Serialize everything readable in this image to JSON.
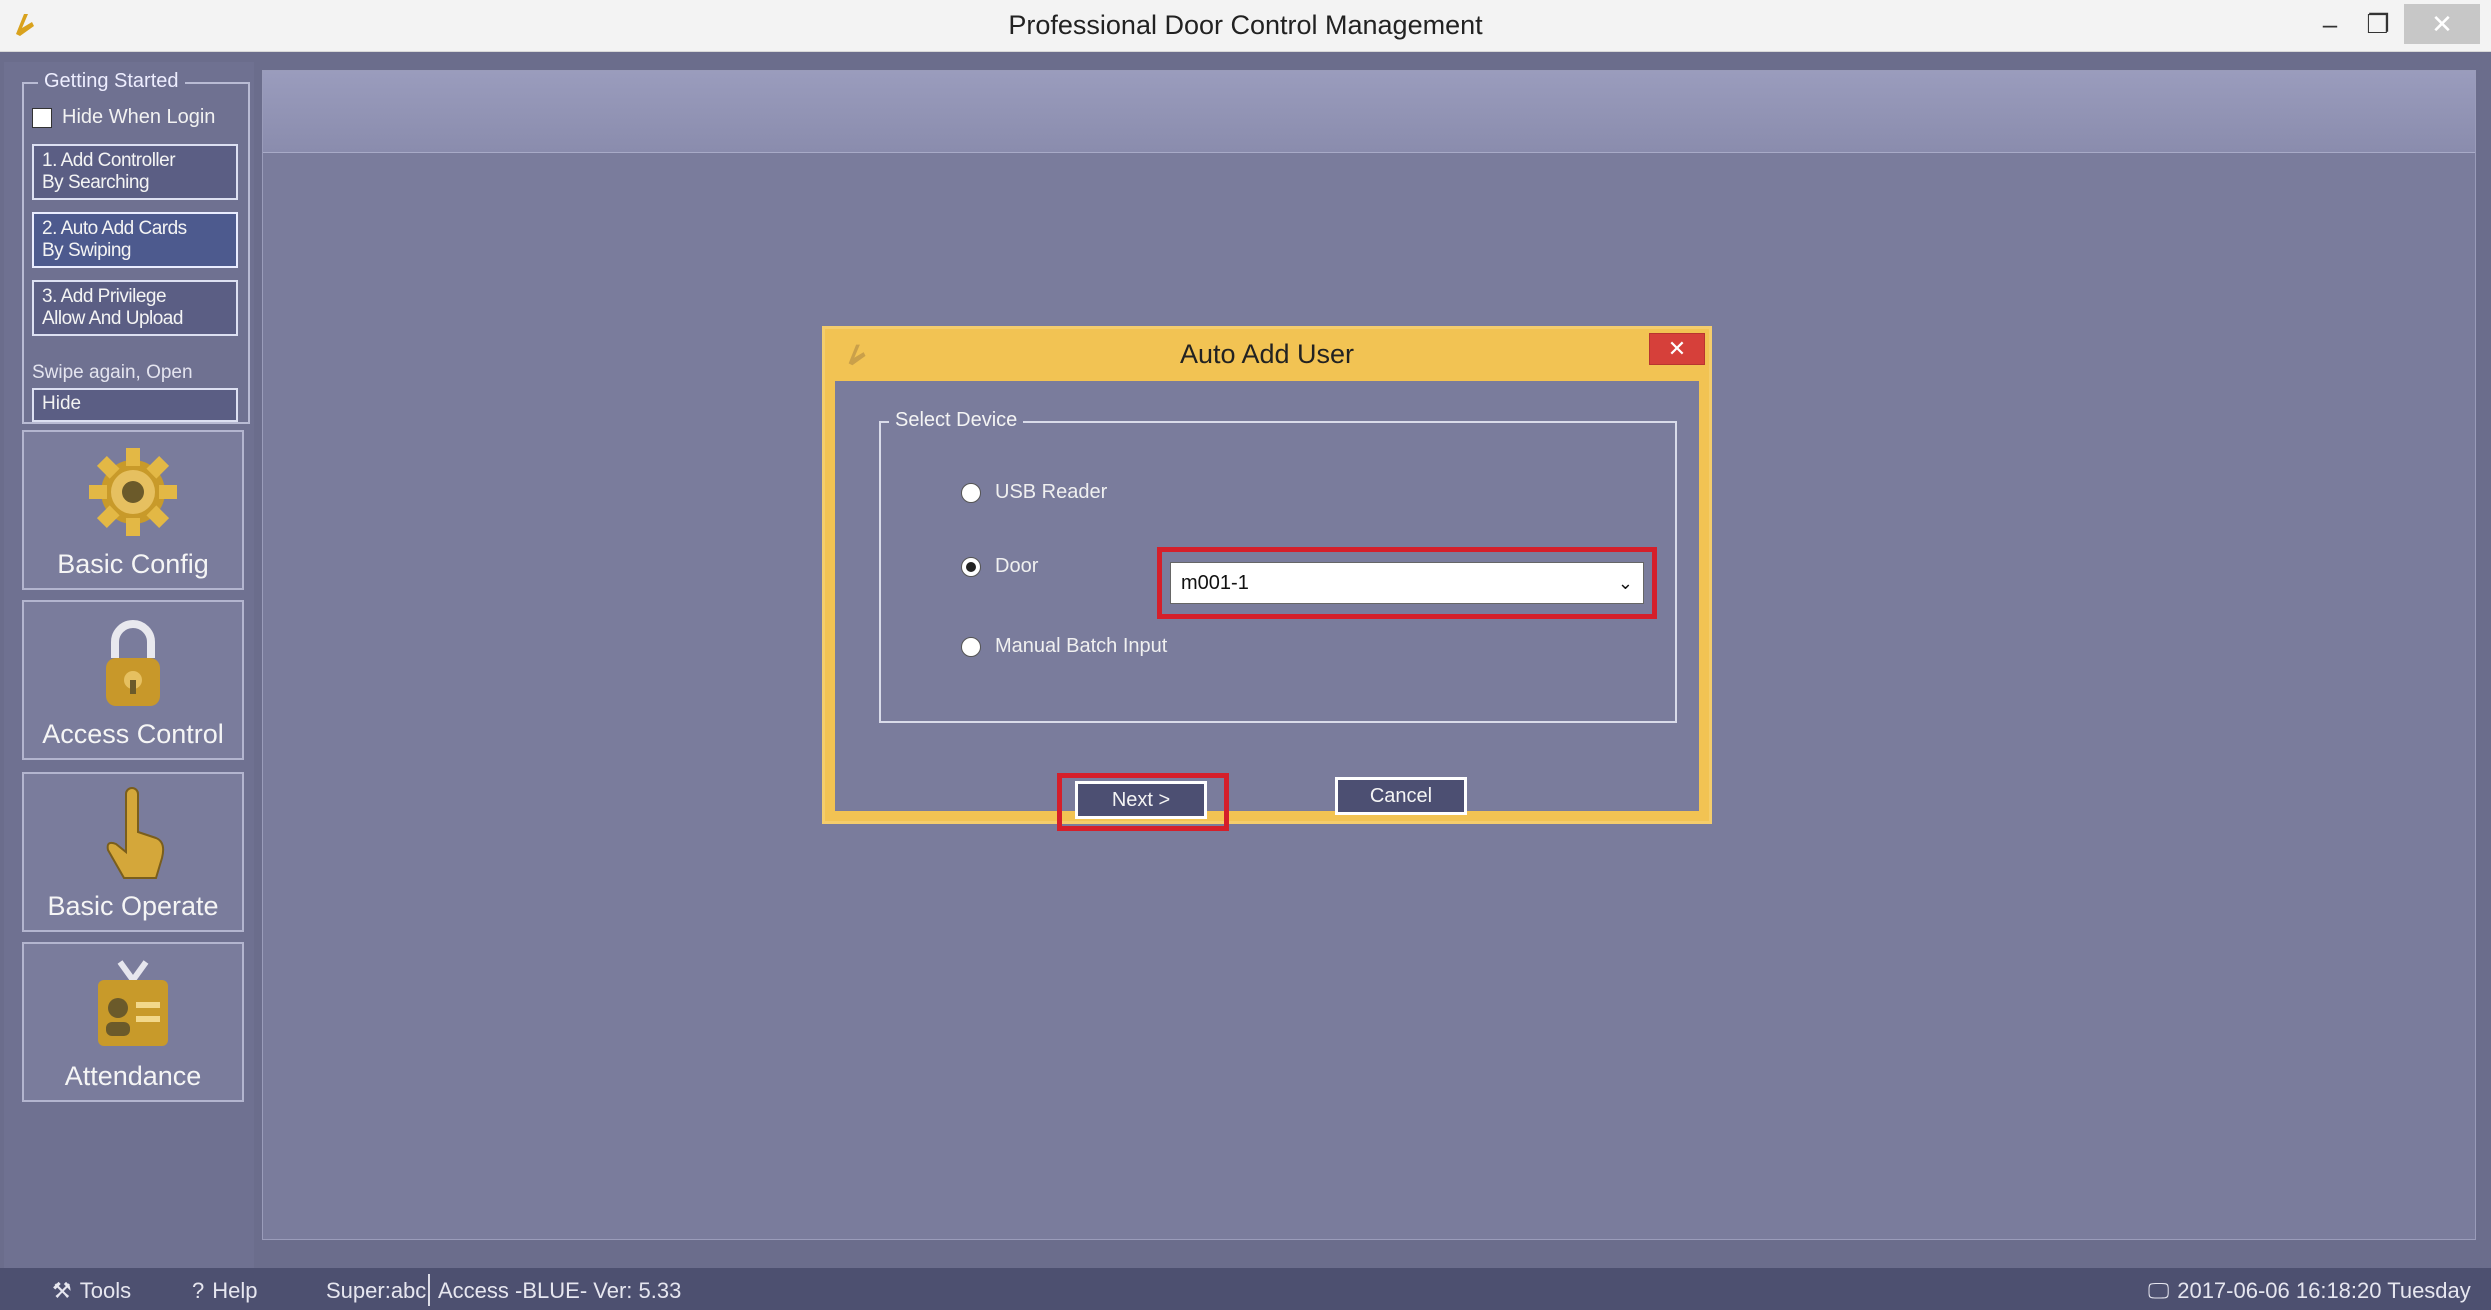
{
  "window": {
    "title": "Professional Door Control Management",
    "minimize": "–",
    "restore": "❐",
    "close": "✕"
  },
  "getting_started": {
    "legend": "Getting Started",
    "hide_when_login": "Hide When Login",
    "steps": [
      {
        "line1": "1. Add Controller",
        "line2": "By Searching"
      },
      {
        "line1": "2. Auto Add Cards",
        "line2": "By Swiping"
      },
      {
        "line1": "3. Add Privilege",
        "line2": "Allow And Upload"
      }
    ],
    "swipe_text": "Swipe again, Open",
    "hide_button": "Hide"
  },
  "nav": [
    {
      "label": "Basic Config",
      "icon": "gear-icon"
    },
    {
      "label": "Access Control",
      "icon": "lock-icon"
    },
    {
      "label": "Basic Operate",
      "icon": "hand-pointer-icon"
    },
    {
      "label": "Attendance",
      "icon": "id-card-icon"
    }
  ],
  "dialog": {
    "title": "Auto Add User",
    "close": "✕",
    "group_legend": "Select Device",
    "options": [
      {
        "label": "USB Reader",
        "selected": false
      },
      {
        "label": "Door",
        "selected": true
      },
      {
        "label": "Manual Batch Input",
        "selected": false
      }
    ],
    "door_value": "m001-1",
    "next_button": "Next >",
    "cancel_button": "Cancel"
  },
  "statusbar": {
    "tools": "Tools",
    "help": "Help",
    "user": "Super:abc",
    "version": "Access -BLUE- Ver: 5.33",
    "datetime": "2017-06-06 16:18:20 Tuesday"
  },
  "colors": {
    "dialog_frame": "#f2c353",
    "highlight_red": "#d51f2a",
    "app_background": "#6b6d8c"
  }
}
